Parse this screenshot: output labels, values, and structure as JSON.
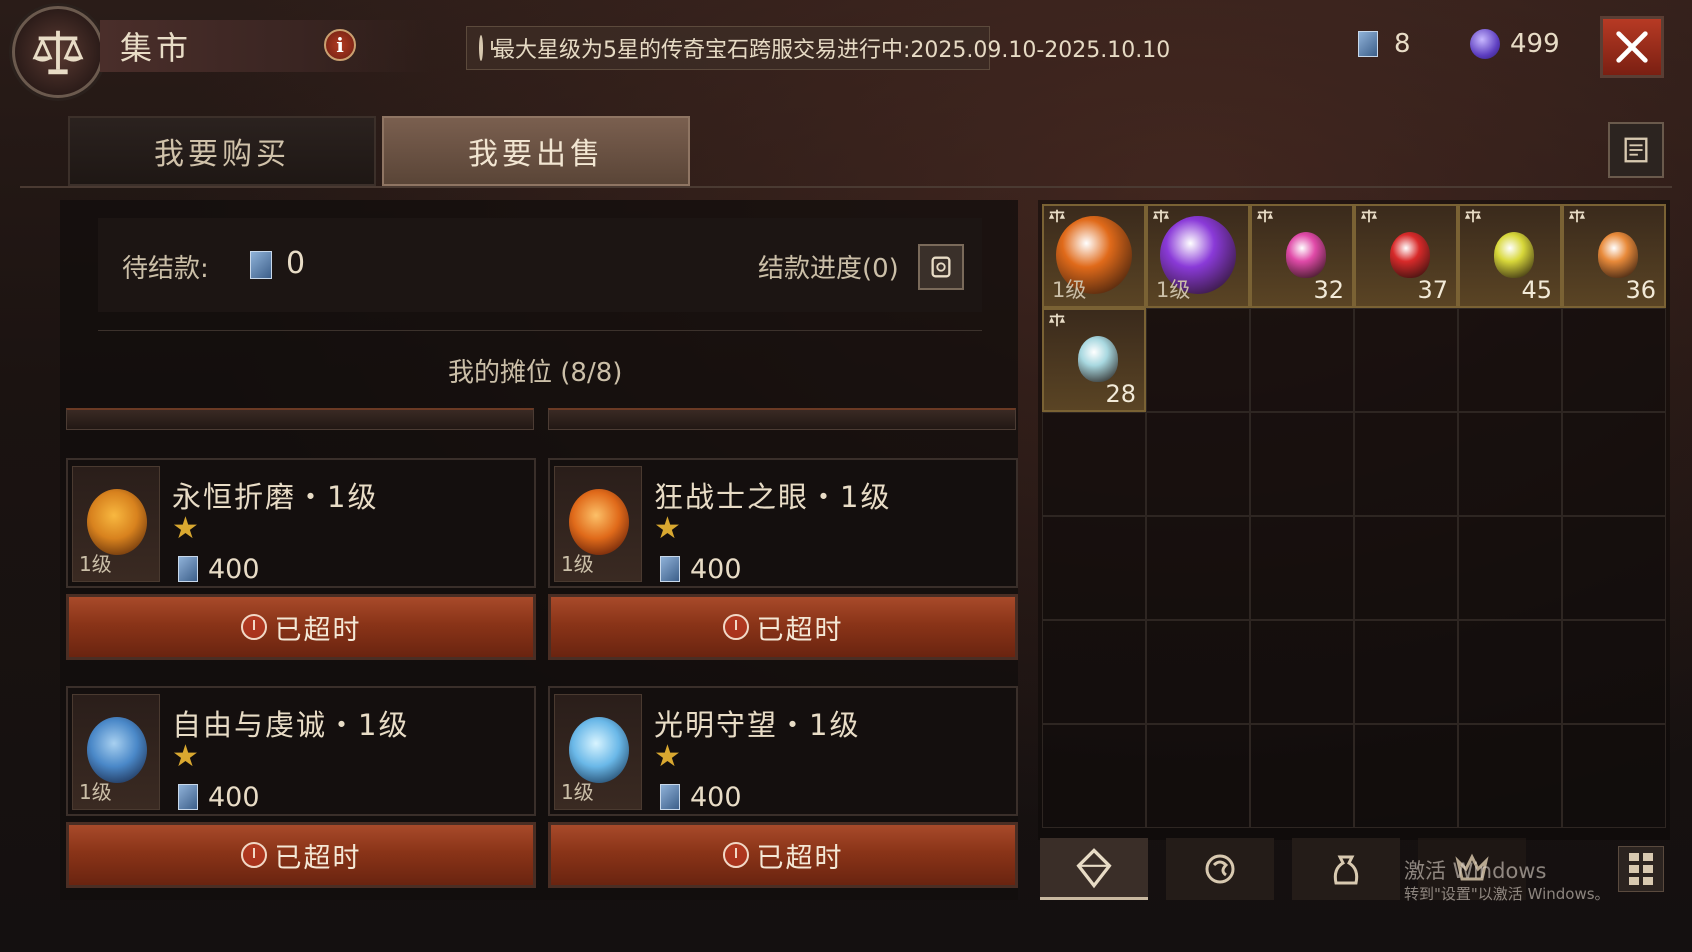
{
  "header": {
    "title": "集市",
    "info_label": "i",
    "notice": "最大星级为5星的传奇宝石跨服交易进行中:2025.09.10-2025.10.10",
    "currency_cards": "8",
    "currency_orbs": "499"
  },
  "tabs": [
    {
      "label": "我要购买",
      "active": false
    },
    {
      "label": "我要出售",
      "active": true
    }
  ],
  "settlement": {
    "pending_label": "待结款:",
    "pending_amount": "0",
    "progress_label": "结款进度(0)"
  },
  "stall": {
    "title": "我的摊位 (8/8)",
    "items": [
      {
        "name": "永恒折磨・1级",
        "level": "1级",
        "stars": "★",
        "price": "400",
        "status": "已超时",
        "gem_color": "#d8821e"
      },
      {
        "name": "狂战士之眼・1级",
        "level": "1级",
        "stars": "★",
        "price": "400",
        "status": "已超时",
        "gem_color": "#e06a1a"
      },
      {
        "name": "自由与虔诚・1级",
        "level": "1级",
        "stars": "★",
        "price": "400",
        "status": "已超时",
        "gem_color": "#4a88c8"
      },
      {
        "name": "光明守望・1级",
        "level": "1级",
        "stars": "★",
        "price": "400",
        "status": "已超时",
        "gem_color": "#6ab8e8"
      }
    ]
  },
  "inventory": {
    "items": [
      {
        "type": "legendary-gem",
        "level": "1级",
        "count": "",
        "color": "#e06a1a",
        "icon": "berserker-eye-gem-icon"
      },
      {
        "type": "legendary-gem",
        "level": "1级",
        "count": "",
        "color": "#8a3ad8",
        "icon": "purple-crystal-gem-icon"
      },
      {
        "type": "gem",
        "level": "",
        "count": "32",
        "color": "#e04aa8",
        "icon": "amethyst-gem-icon"
      },
      {
        "type": "gem",
        "level": "",
        "count": "37",
        "color": "#d82a2a",
        "icon": "ruby-gem-icon"
      },
      {
        "type": "gem",
        "level": "",
        "count": "45",
        "color": "#d8d83a",
        "icon": "topaz-gem-icon"
      },
      {
        "type": "gem",
        "level": "",
        "count": "36",
        "color": "#e88a3a",
        "icon": "amber-gem-icon"
      },
      {
        "type": "gem",
        "level": "",
        "count": "28",
        "color": "#a8d8e0",
        "icon": "diamond-gem-icon"
      }
    ],
    "total_slots": 36
  },
  "bottom_bar": {
    "watermark_line1": "激活 Windows",
    "watermark_line2": "转到\"设置\"以激活 Windows。"
  },
  "colors": {
    "accent_red": "#a84a2a",
    "star_gold": "#d9a830"
  }
}
